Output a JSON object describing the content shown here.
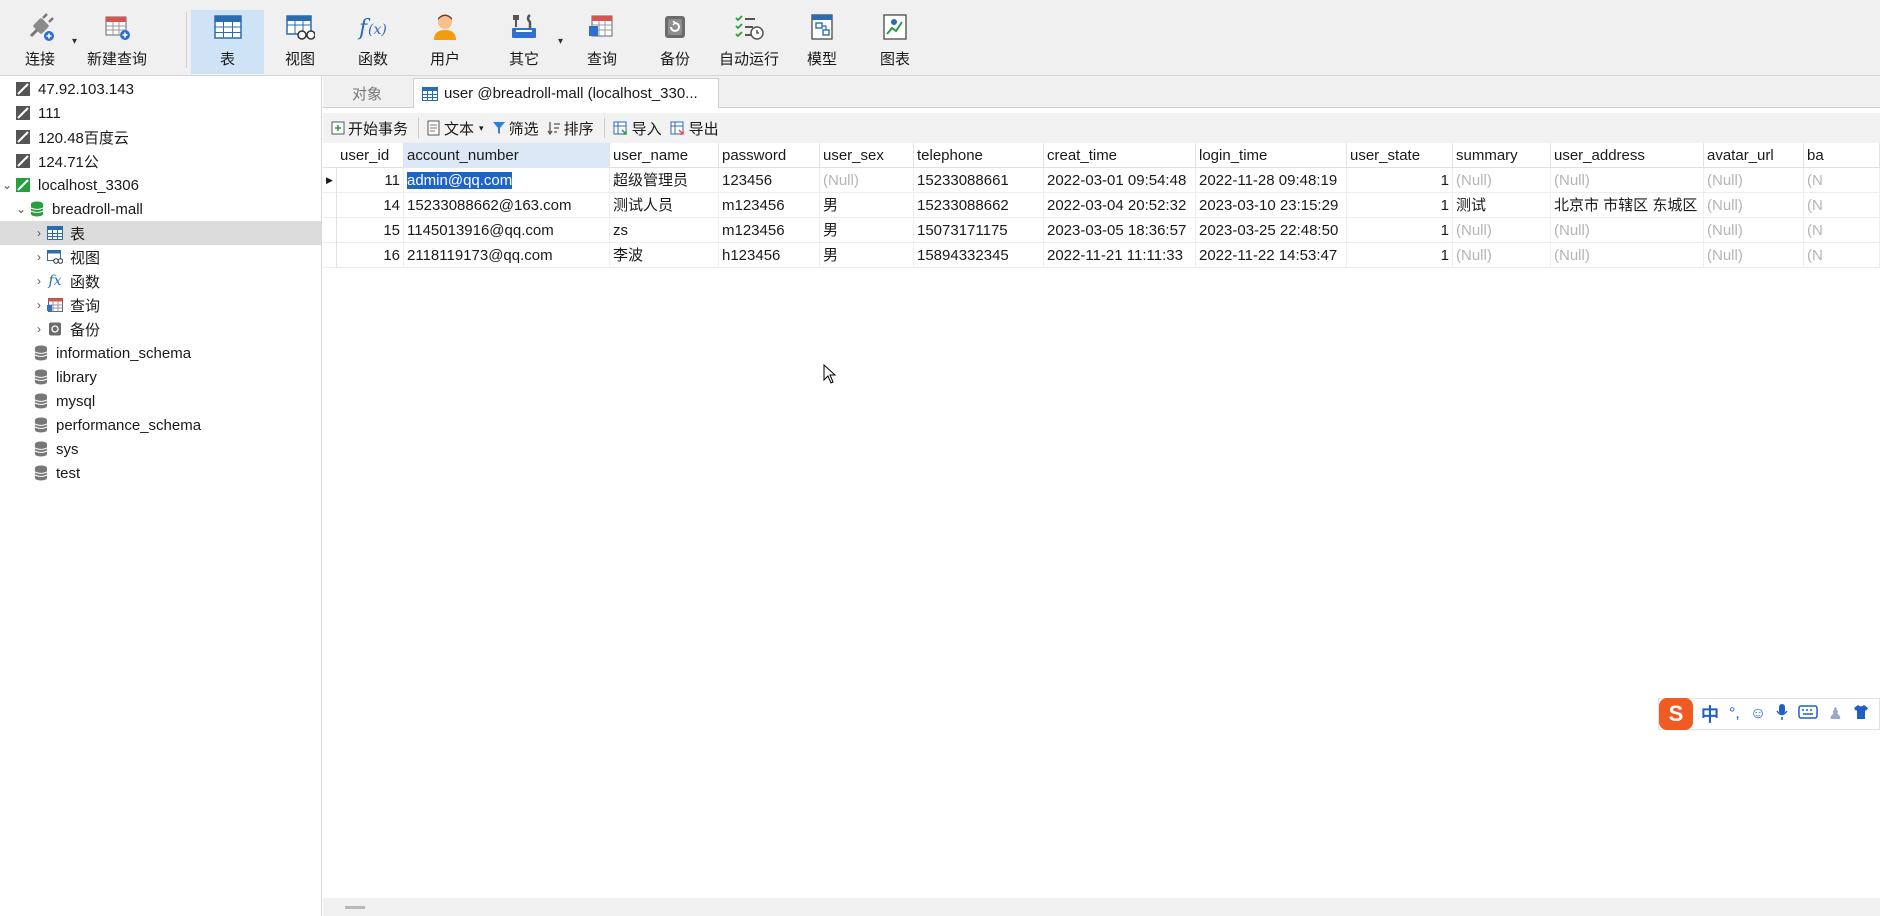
{
  "toolbar": {
    "buttons": [
      {
        "label": "连接"
      },
      {
        "label": "新建查询"
      },
      {
        "label": "表"
      },
      {
        "label": "视图"
      },
      {
        "label": "函数"
      },
      {
        "label": "用户"
      },
      {
        "label": "其它"
      },
      {
        "label": "查询"
      },
      {
        "label": "备份"
      },
      {
        "label": "自动运行"
      },
      {
        "label": "模型"
      },
      {
        "label": "图表"
      }
    ],
    "colors": {
      "active_bg": "#cfe3f7",
      "accent": "#1e64c8"
    }
  },
  "sidebar": {
    "connections": [
      {
        "label": "47.92.103.143",
        "icon": "connection-icon"
      },
      {
        "label": "111",
        "icon": "connection-icon"
      },
      {
        "label": "120.48百度云",
        "icon": "connection-icon"
      },
      {
        "label": "124.71公",
        "icon": "connection-icon"
      },
      {
        "label": "localhost_3306",
        "icon": "connection-active-icon"
      }
    ],
    "database": {
      "label": "breadroll-mall",
      "icon": "database-icon"
    },
    "db_children": [
      {
        "label": "表",
        "icon": "table-icon"
      },
      {
        "label": "视图",
        "icon": "view-icon"
      },
      {
        "label": "函数",
        "icon": "function-icon"
      },
      {
        "label": "查询",
        "icon": "query-icon"
      },
      {
        "label": "备份",
        "icon": "backup-icon"
      }
    ],
    "other_databases": [
      {
        "label": "information_schema"
      },
      {
        "label": "library"
      },
      {
        "label": "mysql"
      },
      {
        "label": "performance_schema"
      },
      {
        "label": "sys"
      },
      {
        "label": "test"
      }
    ]
  },
  "tabs": {
    "objects_label": "对象",
    "current_label": "user @breadroll-mall (localhost_330..."
  },
  "subtoolbar": {
    "begin_transaction": "开始事务",
    "text": "文本",
    "filter": "筛选",
    "sort": "排序",
    "import": "导入",
    "export": "导出"
  },
  "grid": {
    "columns": [
      "user_id",
      "account_number",
      "user_name",
      "password",
      "user_sex",
      "telephone",
      "creat_time",
      "login_time",
      "user_state",
      "summary",
      "user_address",
      "avatar_url",
      "ba"
    ],
    "rows": [
      [
        "11",
        "admin@qq.com",
        "超级管理员",
        "123456",
        "(Null)",
        "15233088661",
        "2022-03-01 09:54:48",
        "2022-11-28 09:48:19",
        "1",
        "(Null)",
        "(Null)",
        "(Null)",
        "(N"
      ],
      [
        "14",
        "15233088662@163.com",
        "测试人员",
        "m123456",
        "男",
        "15233088662",
        "2022-03-04 20:52:32",
        "2023-03-10 23:15:29",
        "1",
        "测试",
        "北京市 市辖区 东城区",
        "(Null)",
        "(N"
      ],
      [
        "15",
        "1145013916@qq.com",
        "zs",
        "m123456",
        "男",
        "15073171175",
        "2023-03-05 18:36:57",
        "2023-03-25 22:48:50",
        "1",
        "(Null)",
        "(Null)",
        "(Null)",
        "(N"
      ],
      [
        "16",
        "2118119173@qq.com",
        "李波",
        "h123456",
        "男",
        "15894332345",
        "2022-11-21 11:11:33",
        "2022-11-22 14:53:47",
        "1",
        "(Null)",
        "(Null)",
        "(Null)",
        "(N"
      ]
    ]
  },
  "ime": {
    "logo": "S",
    "mode": "中",
    "punct": "°,"
  }
}
